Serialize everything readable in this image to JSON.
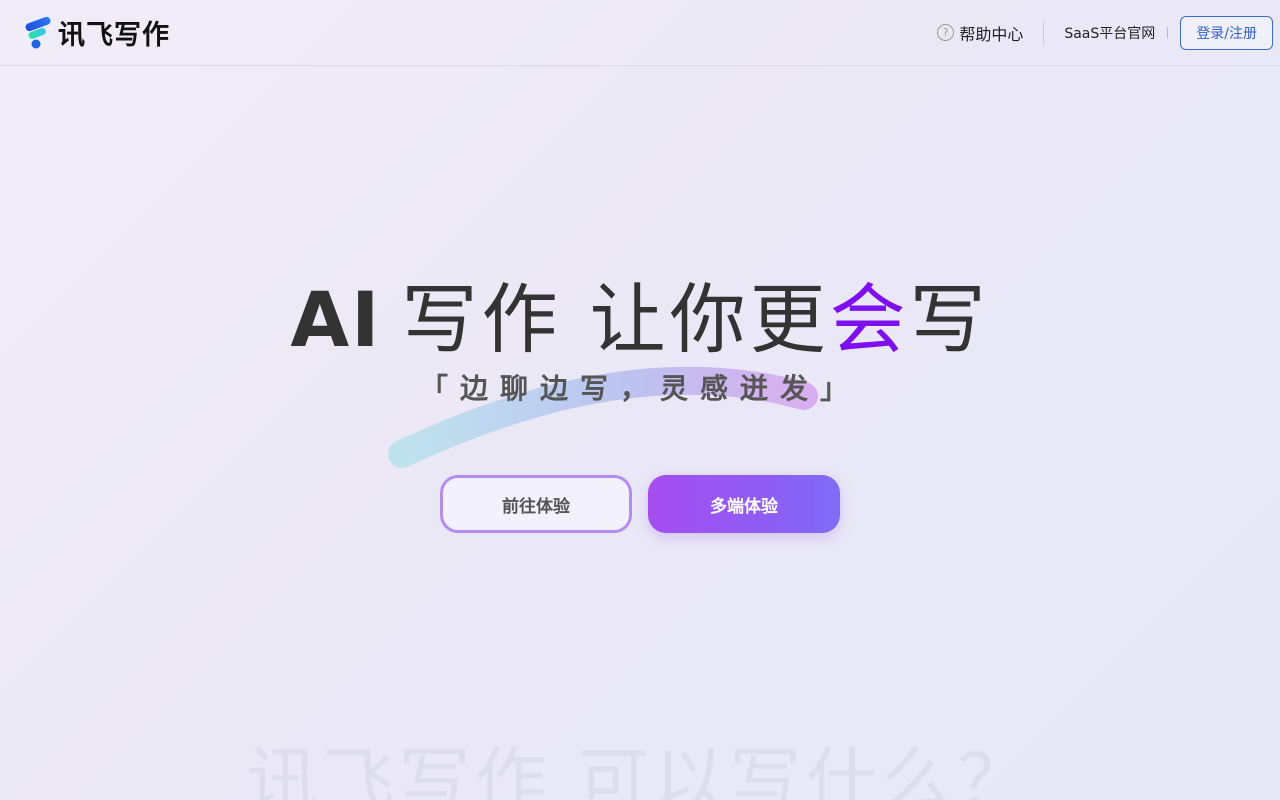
{
  "header": {
    "brand_name": "讯飞写作",
    "help_label": "帮助中心",
    "saas_label": "SaaS平台官网",
    "login_label": "登录/注册"
  },
  "hero": {
    "title_ai": "AI",
    "title_main": "写作 让你更",
    "title_highlight": "会",
    "title_end": "写",
    "slogan": "「边聊边写，灵感迸发」",
    "primary_button": "前往体验",
    "secondary_button": "多端体验"
  },
  "next_section": {
    "heading": "讯飞写作 可以写什么？"
  },
  "colors": {
    "highlight": "#7d0ff0",
    "login_border": "#3a6cd6",
    "button_gradient_start": "#a64df0",
    "button_gradient_end": "#7e6cf7"
  }
}
